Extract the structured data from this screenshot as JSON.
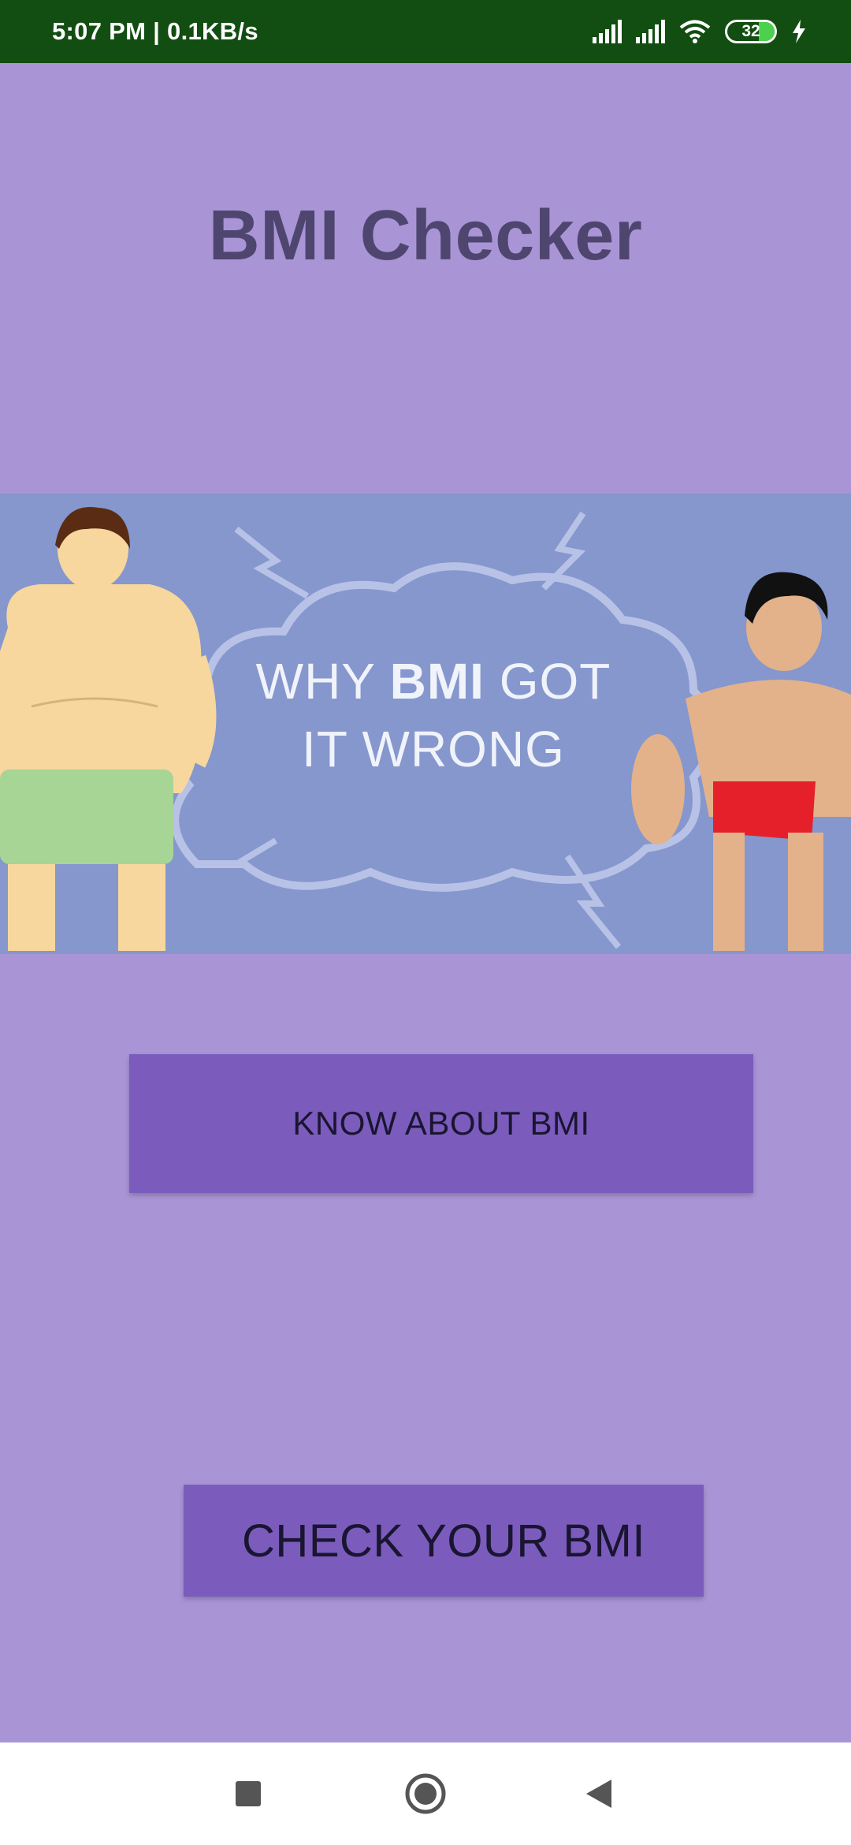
{
  "status_bar": {
    "time_speed": "5:07 PM | 0.1KB/s",
    "battery": "32",
    "icons": [
      "signal-icon",
      "signal-icon",
      "wifi-icon",
      "battery-icon",
      "charging-icon"
    ]
  },
  "app": {
    "title": "BMI Checker",
    "banner": {
      "text_line1_a": "WHY ",
      "text_line1_b": "BMI",
      "text_line1_c": " GOT",
      "text_line2": "IT WRONG"
    },
    "know_button_label": "KNOW ABOUT BMI",
    "check_button_label": "CHECK YOUR BMI"
  },
  "nav_bar": {
    "icons": [
      "recents-icon",
      "home-icon",
      "back-icon"
    ]
  },
  "colors": {
    "status_bar": "#124d12",
    "background": "#a995d6",
    "button": "#7b5cbd",
    "title": "#4f4670",
    "banner": "#8597cd"
  }
}
